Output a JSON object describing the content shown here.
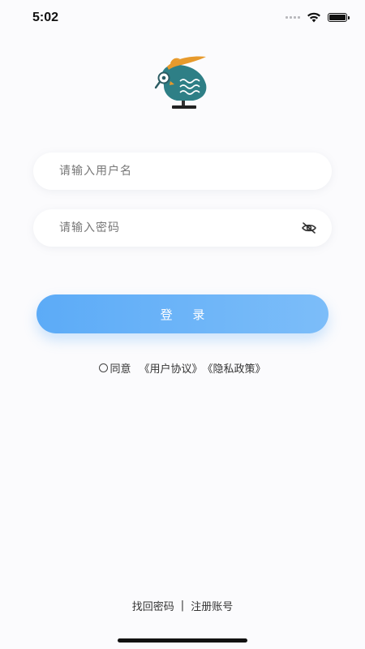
{
  "status_bar": {
    "time": "5:02"
  },
  "login_form": {
    "username_placeholder": "请输入用户名",
    "password_placeholder": "请输入密码",
    "login_label": "登 录"
  },
  "agreement": {
    "agree_label": "同意",
    "user_agreement": "《用户协议》",
    "privacy_policy": "《隐私政策》"
  },
  "footer": {
    "forgot_password": "找回密码",
    "separator": "|",
    "register": "注册账号"
  },
  "icons": {
    "logo": "owl-at-computer-logo",
    "password_toggle": "eye-off-icon",
    "wifi": "wifi-icon",
    "battery": "battery-icon",
    "signal": "signal-icon"
  },
  "colors": {
    "accent": "#5cabf7",
    "logo_teal": "#2e7f86",
    "logo_orange": "#e79a2c",
    "background": "#fbfbfd"
  }
}
